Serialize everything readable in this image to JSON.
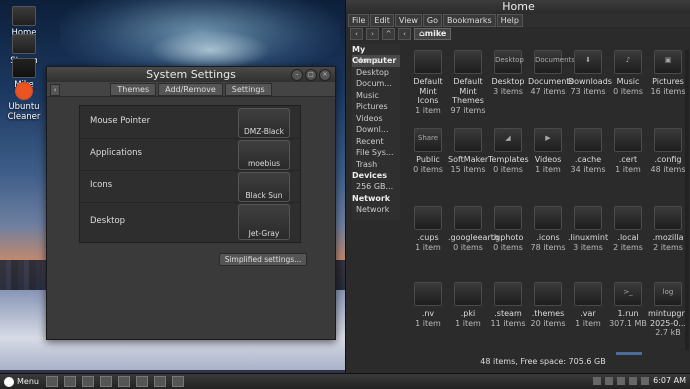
{
  "desktop": {
    "icons": [
      {
        "label": "Home",
        "icon": "folder-icon"
      },
      {
        "label": "Steam",
        "icon": "steam-icon"
      },
      {
        "label": "Mike",
        "icon": "user-folder-icon"
      },
      {
        "label": "Ubuntu Cleaner",
        "icon": "ubuntu-icon"
      }
    ]
  },
  "system_settings": {
    "title": "System Settings",
    "tabs": [
      "Themes",
      "Add/Remove",
      "Settings"
    ],
    "rows": [
      {
        "label": "Mouse Pointer",
        "value": "DMZ-Black"
      },
      {
        "label": "Applications",
        "value": "moebius"
      },
      {
        "label": "Icons",
        "value": "Black Sun"
      },
      {
        "label": "Desktop",
        "value": "Jet-Gray"
      }
    ],
    "simplified_button": "Simplified settings..."
  },
  "file_manager": {
    "title": "Home",
    "menu": [
      "File",
      "Edit",
      "View",
      "Go",
      "Bookmarks",
      "Help"
    ],
    "breadcrumb": "mike",
    "sidebar": {
      "my_computer_header": "My Computer",
      "my_computer": [
        "Home",
        "Desktop",
        "Docum...",
        "Music",
        "Pictures",
        "Videos",
        "Downl...",
        "Recent",
        "File Sys...",
        "Trash"
      ],
      "devices_header": "Devices",
      "devices": [
        "256 GB..."
      ],
      "network_header": "Network",
      "network": [
        "Network"
      ]
    },
    "items": [
      {
        "name": "Default Mint Icons",
        "count": "1 item",
        "glyph": ""
      },
      {
        "name": "Default Mint Themes",
        "count": "97 items",
        "glyph": ""
      },
      {
        "name": "Desktop",
        "count": "3 items",
        "glyph": "Desktop"
      },
      {
        "name": "Documents",
        "count": "47 items",
        "glyph": "Documents"
      },
      {
        "name": "Downloads",
        "count": "73 items",
        "glyph": "⬇"
      },
      {
        "name": "Music",
        "count": "0 items",
        "glyph": "♪"
      },
      {
        "name": "Pictures",
        "count": "16 items",
        "glyph": "▣"
      },
      {
        "name": "Public",
        "count": "0 items",
        "glyph": "Share"
      },
      {
        "name": "SoftMaker",
        "count": "15 items",
        "glyph": ""
      },
      {
        "name": "Templates",
        "count": "0 items",
        "glyph": "◢"
      },
      {
        "name": "Videos",
        "count": "1 item",
        "glyph": "▶"
      },
      {
        "name": ".cache",
        "count": "34 items",
        "glyph": ""
      },
      {
        "name": ".cert",
        "count": "1 item",
        "glyph": ""
      },
      {
        "name": ".config",
        "count": "48 items",
        "glyph": ""
      },
      {
        "name": ".cups",
        "count": "1 item",
        "glyph": ""
      },
      {
        "name": ".googleearth",
        "count": "0 items",
        "glyph": ""
      },
      {
        "name": ".gphoto",
        "count": "0 items",
        "glyph": ""
      },
      {
        "name": ".icons",
        "count": "78 items",
        "glyph": ""
      },
      {
        "name": ".linuxmint",
        "count": "3 items",
        "glyph": ""
      },
      {
        "name": ".local",
        "count": "2 items",
        "glyph": ""
      },
      {
        "name": ".mozilla",
        "count": "2 items",
        "glyph": ""
      },
      {
        "name": ".nv",
        "count": "1 item",
        "glyph": ""
      },
      {
        "name": ".pki",
        "count": "1 item",
        "glyph": ""
      },
      {
        "name": ".steam",
        "count": "11 items",
        "glyph": ""
      },
      {
        "name": ".themes",
        "count": "20 items",
        "glyph": ""
      },
      {
        "name": ".var",
        "count": "1 item",
        "glyph": ""
      },
      {
        "name": "1.run",
        "count": "307.1 MB",
        "glyph": ">_"
      },
      {
        "name": "mintupgrade-2025-0...",
        "count": "2.7 kB",
        "glyph": "log"
      }
    ],
    "status": "48 items, Free space: 705.6 GB"
  },
  "taskbar": {
    "menu_label": "Menu",
    "clock": "6:07 AM"
  }
}
